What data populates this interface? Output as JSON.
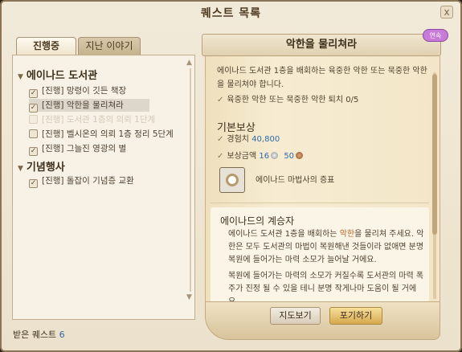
{
  "window": {
    "title": "퀘스트 목록",
    "close_label": "x"
  },
  "tabs": [
    {
      "label": "진행중"
    },
    {
      "label": "지난 이야기"
    }
  ],
  "categories": [
    {
      "name": "에이나드 도서관",
      "quests": [
        {
          "label": "[진행] 망령이 깃든 책장"
        },
        {
          "label": "[진행] 악한을 물리쳐라"
        },
        {
          "label": "[진행] 도서관 1층의 의뢰 1단계"
        },
        {
          "label": "[진행] 벨시온의 의뢰 1층 정리 5단계"
        },
        {
          "label": "[진행] 그늘진 영광의 별"
        }
      ]
    },
    {
      "name": "기념행사",
      "quests": [
        {
          "label": "[진행] 돌잡이 기념증 교환"
        }
      ]
    }
  ],
  "footer": {
    "label": "받은 퀘스트",
    "count": "6"
  },
  "detail": {
    "title": "악한을 물리쳐라",
    "badge": "연속",
    "description": "에이나드 도서관 1층을 배회하는 육중한 악한 또는 묵중한 악한을 물리쳐야 합니다.",
    "objective": "육중한 악한 또는 묵중한 악한 퇴치 0/5",
    "reward_title": "기본보상",
    "exp_label": "경험치",
    "exp_value": "40,800",
    "gold_label": "보상금액",
    "gold_silver": "16",
    "gold_bronze": "50",
    "item_name": "에이나드 마법사의 증표",
    "story_title": "에이나드의 계승자",
    "story_p1_a": "에이나드 도서관 1층을 배회하는 ",
    "story_p1_hl": "악한",
    "story_p1_b": "을 물리쳐 주세요. 악한은 모두 도서관의 마법이 복원해낸 것들이라 없애면 분명 복원에 들어가는 마력 소모가 늘어날 거에요.",
    "story_p2": "복원에 들어가는 마력의 소모가 커질수록 도서관의 마력 폭주가 진정 될 수 있을 테니 분명 작게나마 도움이 될 거에요."
  },
  "buttons": {
    "map": "지도보기",
    "abandon": "포기하기"
  }
}
